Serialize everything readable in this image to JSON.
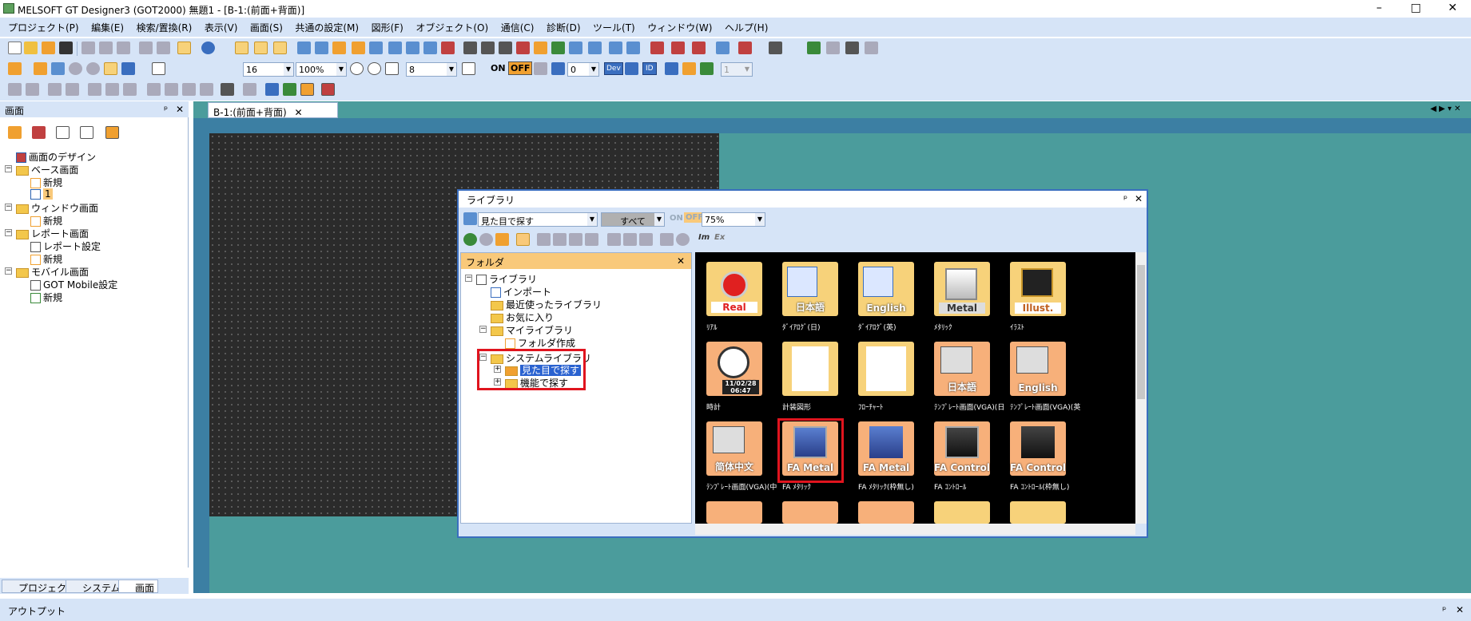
{
  "window": {
    "title": "MELSOFT GT Designer3 (GOT2000) 無題1 - [B-1:(前面+背面)]",
    "min": "–",
    "max": "□",
    "close": "✕"
  },
  "menu": [
    "プロジェクト(P)",
    "編集(E)",
    "検索/置換(R)",
    "表示(V)",
    "画面(S)",
    "共通の設定(M)",
    "図形(F)",
    "オブジェクト(O)",
    "通信(C)",
    "診断(D)",
    "ツール(T)",
    "ウィンドウ(W)",
    "ヘルプ(H)"
  ],
  "toolbar2": {
    "font_size": "16",
    "zoom": "100%",
    "grid": "8",
    "on": "ON",
    "off": "OFF",
    "station": "0",
    "dev": "Dev",
    "id": "ID",
    "page": "1"
  },
  "left_pane": {
    "title": "画面",
    "pin": "ᵖ",
    "close": "✕",
    "tree": {
      "design": "画面のデザイン",
      "base": "ベース画面",
      "base_new": "新規",
      "base_1": "1",
      "window": "ウィンドウ画面",
      "window_new": "新規",
      "report": "レポート画面",
      "report_setting": "レポート設定",
      "report_new": "新規",
      "mobile": "モバイル画面",
      "mobile_setting": "GOT Mobile設定",
      "mobile_new": "新規"
    },
    "tabs": [
      "プロジェクト",
      "システム",
      "画面"
    ]
  },
  "doc_tab": {
    "label": "B-1:(前面+背面)",
    "close": "✕"
  },
  "library": {
    "title": "ライブラリ",
    "search_mode": "見た目で探す",
    "filter": "すべて",
    "on": "ON",
    "off": "OFF",
    "zoom": "75%",
    "folder_title": "フォルダ",
    "folder_close": "✕",
    "tree": {
      "root": "ライブラリ",
      "import": "インポート",
      "recent": "最近使ったライブラリ",
      "favorites": "お気に入り",
      "my_library": "マイライブラリ",
      "make_folder": "フォルダ作成",
      "system_library": "システムライブラリ",
      "look_search": "見た目で探す",
      "func_search": "機能で探す"
    },
    "icons": [
      {
        "caption": "ﾘｱﾙ",
        "label": "Real"
      },
      {
        "caption": "ﾀﾞｲｱﾛｸﾞ(日)",
        "label": "日本語"
      },
      {
        "caption": "ﾀﾞｲｱﾛｸﾞ(英)",
        "label": "English"
      },
      {
        "caption": "ﾒﾀﾘｯｸ",
        "label": "Metal"
      },
      {
        "caption": "ｲﾗｽﾄ",
        "label": "Illust."
      },
      {
        "caption": "時計",
        "label": "11/02/28 06:47"
      },
      {
        "caption": "計装図形",
        "label": ""
      },
      {
        "caption": "ﾌﾛｰﾁｬｰﾄ",
        "label": ""
      },
      {
        "caption": "ﾃﾝﾌﾟﾚｰﾄ画面(VGA)(日",
        "label": "日本語"
      },
      {
        "caption": "ﾃﾝﾌﾟﾚｰﾄ画面(VGA)(英",
        "label": "English"
      },
      {
        "caption": "ﾃﾝﾌﾟﾚｰﾄ画面(VGA)(中",
        "label": "简体中文"
      },
      {
        "caption": "FA ﾒﾀﾘｯｸ",
        "label": "FA Metal"
      },
      {
        "caption": "FA ﾒﾀﾘｯｸ(枠無し)",
        "label": "FA Metal"
      },
      {
        "caption": "FA ｺﾝﾄﾛｰﾙ",
        "label": "FA Control"
      },
      {
        "caption": "FA ｺﾝﾄﾛｰﾙ(枠無し)",
        "label": "FA Control"
      }
    ]
  },
  "output": {
    "title": "アウトプット"
  },
  "colors": {
    "chrome": "#d6e4f7",
    "highlight": "#e0141e",
    "teal": "#4b9c9c",
    "folder": "#f3c74b"
  }
}
